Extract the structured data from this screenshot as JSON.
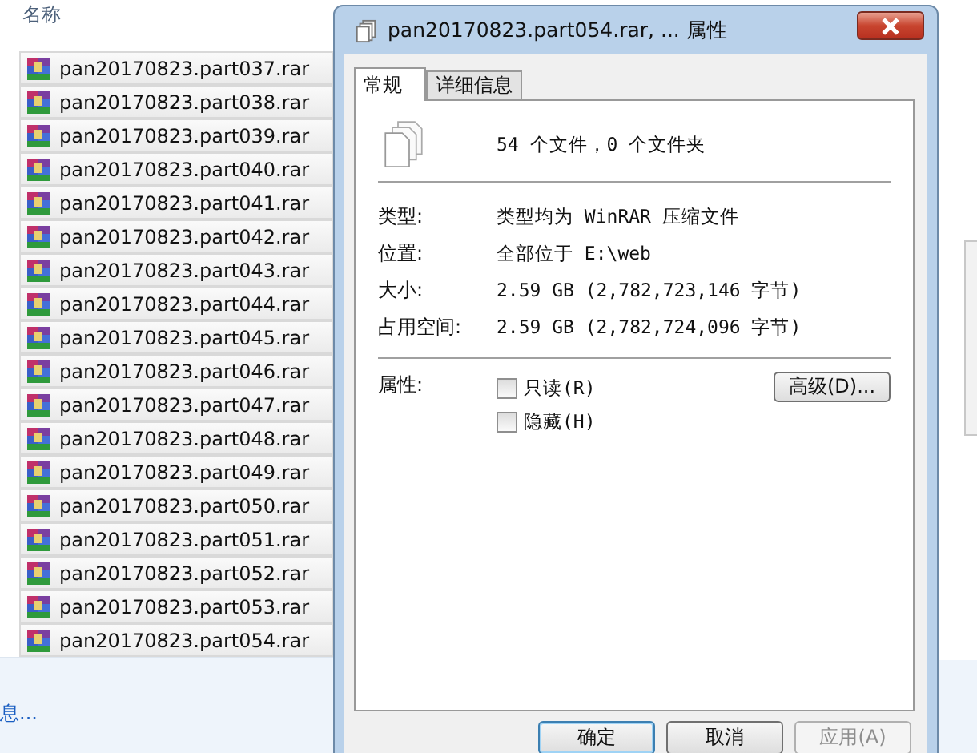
{
  "explorer": {
    "column_header": "名称",
    "files": [
      "pan20170823.part037.rar",
      "pan20170823.part038.rar",
      "pan20170823.part039.rar",
      "pan20170823.part040.rar",
      "pan20170823.part041.rar",
      "pan20170823.part042.rar",
      "pan20170823.part043.rar",
      "pan20170823.part044.rar",
      "pan20170823.part045.rar",
      "pan20170823.part046.rar",
      "pan20170823.part047.rar",
      "pan20170823.part048.rar",
      "pan20170823.part049.rar",
      "pan20170823.part050.rar",
      "pan20170823.part051.rar",
      "pan20170823.part052.rar",
      "pan20170823.part053.rar",
      "pan20170823.part054.rar"
    ],
    "details_link": "息..."
  },
  "dialog": {
    "title": "pan20170823.part054.rar, ... 属性",
    "tabs": [
      {
        "label": "常规",
        "selected": true
      },
      {
        "label": "详细信息",
        "selected": false
      }
    ],
    "summary": "54 个文件，0 个文件夹",
    "properties": [
      {
        "label": "类型:",
        "value": "类型均为 WinRAR 压缩文件"
      },
      {
        "label": "位置:",
        "value": "全部位于 E:\\web"
      },
      {
        "label": "大小:",
        "value": "2.59 GB (2,782,723,146 字节)"
      },
      {
        "label": "占用空间:",
        "value": "2.59 GB (2,782,724,096 字节)"
      }
    ],
    "attributes_label": "属性:",
    "attributes": [
      {
        "label": "只读(R)",
        "checked": false
      },
      {
        "label": "隐藏(H)",
        "checked": false
      }
    ],
    "advanced_button": "高级(D)...",
    "buttons": [
      {
        "label": "确定",
        "default": true,
        "disabled": false
      },
      {
        "label": "取消",
        "default": false,
        "disabled": false
      },
      {
        "label": "应用(A)",
        "default": false,
        "disabled": true
      }
    ]
  }
}
